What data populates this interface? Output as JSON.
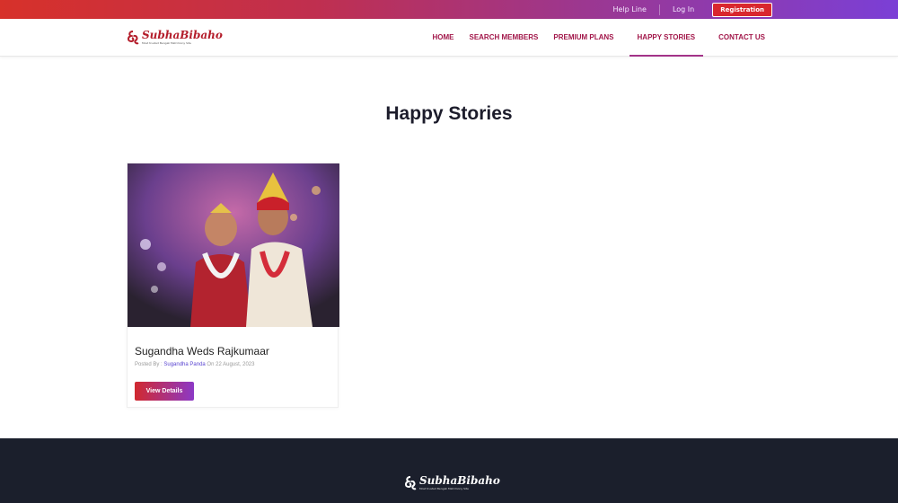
{
  "topbar": {
    "help_line": "Help Line",
    "login": "Log In",
    "registration": "Registration"
  },
  "brand": {
    "name": "SubhaBibaho",
    "tagline": "Most trusted Bengali Matrimony Site",
    "colors": {
      "brand": "#b41d2b",
      "nav": "#a2174a",
      "accent_gradient_start": "#d1292f",
      "accent_gradient_end": "#8c39c6",
      "footer_bg": "#1b1f2c"
    }
  },
  "nav": {
    "items": [
      {
        "label": "HOME"
      },
      {
        "label": "SEARCH MEMBERS"
      },
      {
        "label": "PREMIUM PLANS"
      },
      {
        "label": "HAPPY STORIES",
        "active": true
      },
      {
        "label": "CONTACT US"
      }
    ]
  },
  "page": {
    "title": "Happy Stories"
  },
  "stories": [
    {
      "title": "Sugandha Weds Rajkumaar",
      "posted_by_label": "Posted By :",
      "author": "Sugandha Panda",
      "on_label": "On",
      "date": "22 August, 2023",
      "button": "View Details"
    }
  ]
}
